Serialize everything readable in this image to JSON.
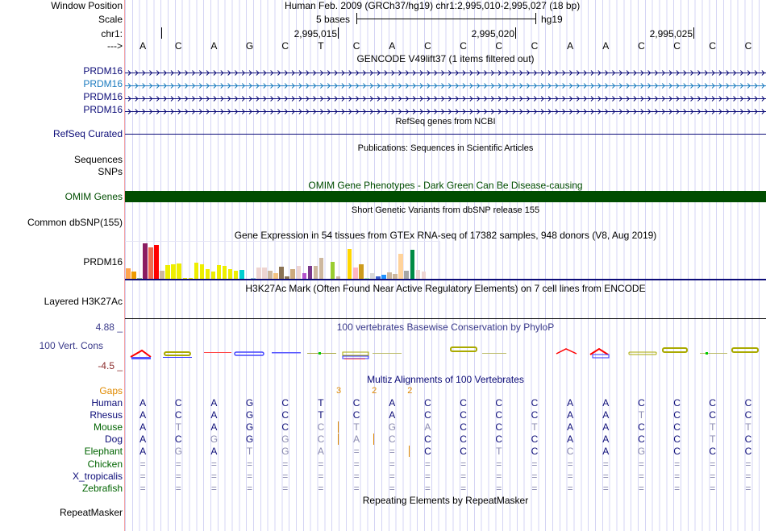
{
  "header": {
    "window_position_label": "Window Position",
    "window_position_text": "Human Feb. 2009 (GRCh37/hg19)   chr1:2,995,010-2,995,027 (18 bp)",
    "scale_label": "Scale",
    "scale_text": "5 bases",
    "scale_assembly": "hg19",
    "chrom_label": "chr1:",
    "positions": [
      "2,995,015",
      "2,995,020",
      "2,995,025"
    ],
    "strand_label": "--->",
    "bases": [
      "A",
      "C",
      "A",
      "G",
      "C",
      "T",
      "C",
      "A",
      "C",
      "C",
      "C",
      "C",
      "A",
      "A",
      "C",
      "C",
      "C",
      "C"
    ]
  },
  "tracks": {
    "gencode": {
      "title": "GENCODE V49lift37 (1 items filtered out)",
      "genes": [
        {
          "label": "PRDM16",
          "color": "#0c0c78"
        },
        {
          "label": "PRDM16",
          "color": "#1a7abf"
        },
        {
          "label": "PRDM16",
          "color": "#0c0c78"
        },
        {
          "label": "PRDM16",
          "color": "#0c0c78"
        }
      ]
    },
    "refseq": {
      "title": "RefSeq genes from NCBI",
      "label": "RefSeq Curated"
    },
    "publications": {
      "title": "Publications: Sequences in Scientific Articles",
      "labels": [
        "Sequences",
        "SNPs"
      ]
    },
    "omim": {
      "title": "OMIM Gene Phenotypes - Dark Green Can Be Disease-causing",
      "label": "OMIM Genes",
      "color": "#004d00"
    },
    "dbsnp": {
      "title": "Short Genetic Variants from dbSNP release 155",
      "label": "Common dbSNP(155)"
    },
    "gtex": {
      "title": "Gene Expression in 54 tissues from GTEx RNA-seq of 17382 samples, 948 donors (V8, Aug 2019)",
      "label": "PRDM16",
      "bars": [
        {
          "v": 14,
          "c": "#FFA54F"
        },
        {
          "v": 10,
          "c": "#EE9A00"
        },
        {
          "v": 2.3,
          "c": "#8FBC8F"
        },
        {
          "v": 45,
          "c": "#8B1C62"
        },
        {
          "v": 40,
          "c": "#EE6A50"
        },
        {
          "v": 43,
          "c": "#FF0000"
        },
        {
          "v": 11,
          "c": "#CDB79E"
        },
        {
          "v": 18,
          "c": "#EEEE00"
        },
        {
          "v": 19,
          "c": "#EEEE00"
        },
        {
          "v": 20,
          "c": "#EEEE00"
        },
        {
          "v": 2,
          "c": "#EEEE00"
        },
        {
          "v": 2.3,
          "c": "#EEEE00"
        },
        {
          "v": 21,
          "c": "#EEEE00"
        },
        {
          "v": 19,
          "c": "#EEEE00"
        },
        {
          "v": 13,
          "c": "#EEEE00"
        },
        {
          "v": 10,
          "c": "#EEEE00"
        },
        {
          "v": 18,
          "c": "#EEEE00"
        },
        {
          "v": 17,
          "c": "#EEEE00"
        },
        {
          "v": 13,
          "c": "#EEEE00"
        },
        {
          "v": 11,
          "c": "#EEEE00"
        },
        {
          "v": 12,
          "c": "#00CED1"
        },
        {
          "v": 0.6,
          "c": "#9AC0CD"
        },
        {
          "v": 1.7,
          "c": "#9AC0CD"
        },
        {
          "v": 15,
          "c": "#EED5D2"
        },
        {
          "v": 15,
          "c": "#EED5D2"
        },
        {
          "v": 11,
          "c": "#CDB79E"
        },
        {
          "v": 8,
          "c": "#F4C27F"
        },
        {
          "v": 16,
          "c": "#8B7355"
        },
        {
          "v": 4,
          "c": "#8B7355"
        },
        {
          "v": 13,
          "c": "#CDAA7D"
        },
        {
          "v": 17,
          "c": "#EED5D2"
        },
        {
          "v": 8,
          "c": "#B452CD"
        },
        {
          "v": 17,
          "c": "#7A378B"
        },
        {
          "v": 17,
          "c": "#CDB79E"
        },
        {
          "v": 27,
          "c": "#CDB79E"
        },
        {
          "v": 0.7,
          "c": "#CDB79E"
        },
        {
          "v": 22,
          "c": "#9ACD32"
        },
        {
          "v": 4,
          "c": "#CDB79E"
        },
        {
          "v": 1.3,
          "c": "#7B68EE"
        },
        {
          "v": 38,
          "c": "#FFD700"
        },
        {
          "v": 15,
          "c": "#FFB6C1"
        },
        {
          "v": 19,
          "c": "#CD9B1D"
        },
        {
          "v": 2.3,
          "c": "#B4EEB4"
        },
        {
          "v": 8,
          "c": "#D9D9D9"
        },
        {
          "v": 4,
          "c": "#3A5FCD"
        },
        {
          "v": 6,
          "c": "#1E90FF"
        },
        {
          "v": 9,
          "c": "#CDB79E"
        },
        {
          "v": 7,
          "c": "#CDB79E"
        },
        {
          "v": 32,
          "c": "#FFD39B"
        },
        {
          "v": 11,
          "c": "#A6A6A6"
        },
        {
          "v": 37,
          "c": "#008B45"
        },
        {
          "v": 12,
          "c": "#EED5D2"
        },
        {
          "v": 10,
          "c": "#EED5D2"
        },
        {
          "v": 0.6,
          "c": "#EED5D2"
        }
      ]
    },
    "h3k27ac": {
      "title": "H3K27Ac Mark (Often Found Near Active Regulatory Elements) on 7 cell lines from ENCODE",
      "label": "Layered H3K27Ac"
    },
    "phylop": {
      "title": "100 vertebrates Basewise Conservation by PhyloP",
      "label": "100 Vert. Cons",
      "max": "4.88 _",
      "min": "-4.5 _"
    },
    "multiz": {
      "title": "Multiz Alignments of 100 Vertebrates",
      "gaps_label": "Gaps",
      "gap_counts": [
        {
          "after_col": 6,
          "n": "3"
        },
        {
          "after_col": 7,
          "n": "2"
        },
        {
          "after_col": 8,
          "n": "2"
        }
      ],
      "species": [
        {
          "name": "Human",
          "color": "#0c0c78",
          "seq": "ACAGCTCACCCCAACCCC",
          "faded": ""
        },
        {
          "name": "Rhesus",
          "color": "#0c0c78",
          "seq": "ACAGCTCACCCCAATCCC",
          "faded": "00000000000000100 0"
        },
        {
          "name": "Mouse",
          "color": "#006400",
          "seq": "ATAGCCTGACCTAACCTT",
          "faded": "010001111001000011"
        },
        {
          "name": "Dog",
          "color": "#0c0c78",
          "seq": "ACGGGCACCCCCAACCTC",
          "faded": "001011110000000010"
        },
        {
          "name": "Elephant",
          "color": "#006400",
          "seq": "AGATGA==CCTCCAGCCC",
          "faded": "010111110010101000"
        },
        {
          "name": "Chicken",
          "color": "#006400",
          "seq": "==================",
          "faded": "111111111111111111"
        },
        {
          "name": "X_tropicalis",
          "color": "#0c0c78",
          "seq": "==================",
          "faded": "111111111111111111"
        },
        {
          "name": "Zebrafish",
          "color": "#006400",
          "seq": "==================",
          "faded": "111111111111111111"
        }
      ]
    },
    "repeatmasker": {
      "title": "Repeating Elements by RepeatMasker",
      "label": "RepeatMasker"
    }
  }
}
